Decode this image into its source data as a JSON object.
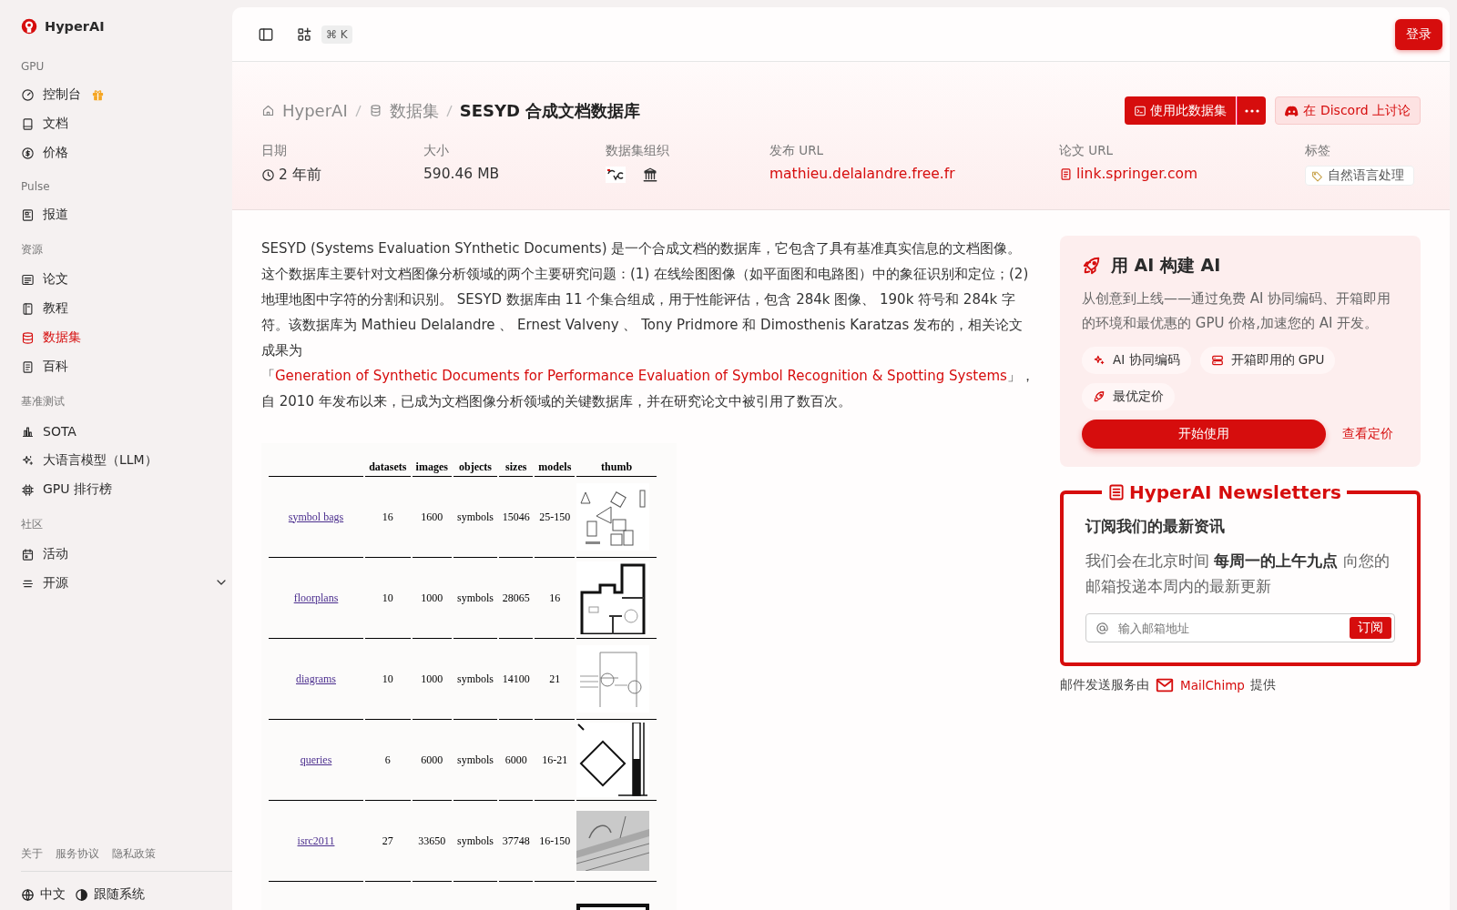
{
  "sidebar": {
    "brand": "HyperAI",
    "sections": [
      {
        "title": "GPU",
        "items": [
          {
            "label": "控制台",
            "kind": "gift",
            "selected": false
          },
          {
            "label": "文档",
            "kind": "plain",
            "selected": false
          },
          {
            "label": "价格",
            "kind": "plain",
            "selected": false
          }
        ]
      },
      {
        "title": "Pulse",
        "items": [
          {
            "label": "报道",
            "kind": "plain",
            "selected": false
          }
        ]
      },
      {
        "title": "资源",
        "items": [
          {
            "label": "论文",
            "kind": "plain",
            "selected": false
          },
          {
            "label": "教程",
            "kind": "plain",
            "selected": false
          },
          {
            "label": "数据集",
            "kind": "plain",
            "selected": true
          },
          {
            "label": "百科",
            "kind": "plain",
            "selected": false
          }
        ]
      },
      {
        "title": "基准测试",
        "items": [
          {
            "label": "SOTA",
            "kind": "plain",
            "selected": false
          },
          {
            "label": "大语言模型（LLM）",
            "kind": "plain",
            "selected": false
          },
          {
            "label": "GPU 排行榜",
            "kind": "plain",
            "selected": false
          }
        ]
      },
      {
        "title": "社区",
        "items": [
          {
            "label": "活动",
            "kind": "plain",
            "selected": false
          },
          {
            "label": "开源",
            "kind": "expandable",
            "expanded": false,
            "selected": false
          }
        ]
      }
    ],
    "footer_links": [
      "关于",
      "服务协议",
      "隐私政策"
    ],
    "language": "中文",
    "theme": "跟随系统"
  },
  "topbar": {
    "shortcut": "⌘ K",
    "login_button": "登录"
  },
  "header": {
    "breadcrumb": [
      "HyperAI",
      "数据集",
      "SESYD 合成文档数据库"
    ],
    "use_button": "使用此数据集",
    "discord_button": "在 Discord 上讨论",
    "meta": [
      {
        "label": "日期",
        "value": "2 年前",
        "kind": "time"
      },
      {
        "label": "大小",
        "value": "590.46 MB",
        "kind": "text"
      },
      {
        "label": "数据集组织",
        "kind": "logos"
      },
      {
        "label": "发布 URL",
        "value": "mathieu.delalandre.free.fr",
        "kind": "link"
      },
      {
        "label": "论文 URL",
        "value": "link.springer.com",
        "kind": "doc-link"
      },
      {
        "label": "标签",
        "value": "自然语言处理",
        "kind": "tag"
      }
    ]
  },
  "description": {
    "before": "SESYD (Systems Evaluation SYnthetic Documents) 是一个合成文档的数据库，它包含了具有基准真实信息的文档图像。这个数据库主要针对文档图像分析领域的两个主要研究问题：(1) 在线绘图图像（如平面图和电路图）中的象征识别和定位；(2) 地理地图中字符的分割和识别。 SESYD 数据库由 11 个集合组成，用于性能评估，包含 284k 图像、 190k 符号和 284k 字符。该数据库为 Mathieu Delalandre 、 Ernest Valveny 、 Tony Pridmore 和 Dimosthenis Karatzas 发布的，相关论文成果为「",
    "link": "Generation of Synthetic Documents for Performance Evaluation of Symbol Recognition & Spotting Systems",
    "after": "」，自 2010 年发布以来，已成为文档图像分析领域的关键数据库，并在研究论文中被引用了数百次。"
  },
  "table": {
    "columns": [
      "datasets",
      "images",
      "objects",
      "sizes",
      "models",
      "thumb"
    ],
    "rows": [
      {
        "kind": "row",
        "name": "symbol bags",
        "cells": [
          "16",
          "1600",
          "symbols",
          "15046",
          "25-150"
        ]
      },
      {
        "kind": "row",
        "name": "floorplans",
        "cells": [
          "10",
          "1000",
          "symbols",
          "28065",
          "16"
        ]
      },
      {
        "kind": "row",
        "name": "diagrams",
        "cells": [
          "10",
          "1000",
          "symbols",
          "14100",
          "21"
        ]
      },
      {
        "kind": "row",
        "name": "queries",
        "cells": [
          "6",
          "6000",
          "symbols",
          "6000",
          "16-21"
        ]
      },
      {
        "kind": "row",
        "name": "isrc2011",
        "cells": [
          "27",
          "33650",
          "symbols",
          "37748",
          "16-150"
        ]
      },
      {
        "kind": "partial"
      }
    ]
  },
  "promo": {
    "title": "用 AI 构建 AI",
    "text": "从创意到上线——通过免费 AI 协同编码、开箱即用的环境和最优惠的 GPU 价格,加速您的 AI 开发。",
    "chips": [
      "AI 协同编码",
      "开箱即用的 GPU",
      "最优定价"
    ],
    "start_button": "开始使用",
    "pricing_link": "查看定价"
  },
  "newsletter": {
    "legend": "HyperAI Newsletters",
    "heading": "订阅我们的最新资讯",
    "text": "我们会在北京时间 **每周一的上午九点** 向您的邮箱投递本周内的最新更新",
    "placeholder": "输入邮箱地址",
    "subscribe_button": "订阅"
  },
  "mail_credit": {
    "before": "邮件发送服务由",
    "brand": "MailChimp",
    "after": "提供"
  }
}
